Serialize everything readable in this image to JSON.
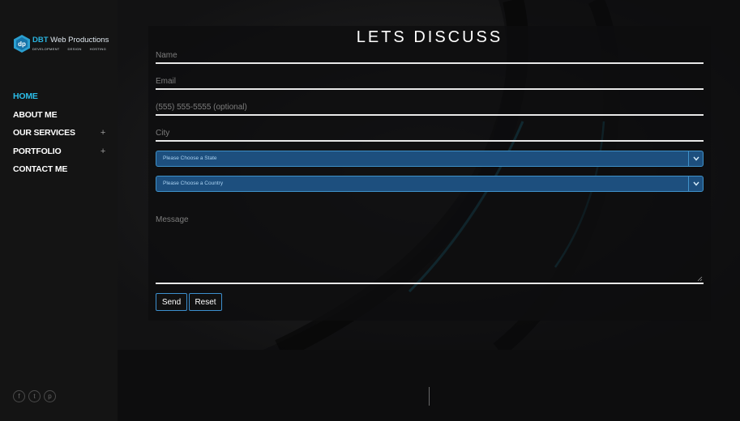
{
  "brand": {
    "name_prefix": "DBT",
    "name_rest": " Web Productions",
    "tagline": [
      "DEVELOPMENT",
      "DESIGN",
      "HOSTING"
    ],
    "logo_icon": "dp-logo-icon"
  },
  "nav": {
    "items": [
      {
        "label": "HOME",
        "active": true,
        "expandable": false
      },
      {
        "label": "ABOUT ME",
        "active": false,
        "expandable": false
      },
      {
        "label": "OUR SERVICES",
        "active": false,
        "expandable": true
      },
      {
        "label": "PORTFOLIO",
        "active": false,
        "expandable": true
      },
      {
        "label": "CONTACT ME",
        "active": false,
        "expandable": false
      }
    ],
    "expand_symbol": "+"
  },
  "socials": [
    {
      "icon": "facebook-icon",
      "glyph": "f"
    },
    {
      "icon": "twitter-icon",
      "glyph": "t"
    },
    {
      "icon": "pinterest-icon",
      "glyph": "p"
    }
  ],
  "form": {
    "title": "LETS DISCUSS",
    "name_placeholder": "Name",
    "email_placeholder": "Email",
    "phone_placeholder": "(555) 555-5555 (optional)",
    "city_placeholder": "City",
    "state_selected": "Please Choose a State",
    "country_selected": "Please Choose a Country",
    "message_placeholder": "Message",
    "send_label": "Send",
    "reset_label": "Reset"
  },
  "colors": {
    "accent": "#2bbde8",
    "select_bg": "#1d4f7e",
    "select_border": "#3f91c9",
    "sidebar_bg": "#141414"
  }
}
